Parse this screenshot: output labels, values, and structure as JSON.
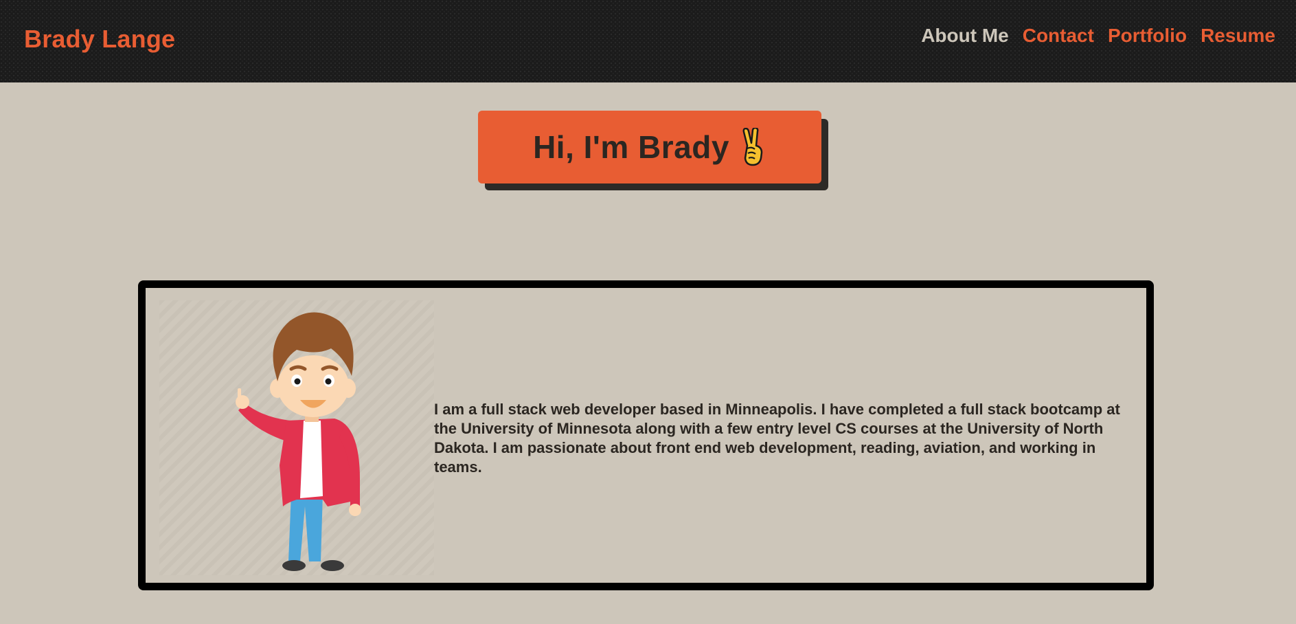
{
  "brand": {
    "name": "Brady Lange"
  },
  "nav": {
    "items": [
      {
        "label": "About Me",
        "active": true
      },
      {
        "label": "Contact",
        "active": false
      },
      {
        "label": "Portfolio",
        "active": false
      },
      {
        "label": "Resume",
        "active": false
      }
    ]
  },
  "hero": {
    "title": "Hi, I'm Brady",
    "icon": "victory-hand-icon"
  },
  "about": {
    "avatar": "cartoon-avatar",
    "bio": "I am a full stack web developer based in Minneapolis. I have completed a full stack bootcamp at the University of Minnesota along with a few entry level CS courses at the University of North Dakota. I am passionate about front end web development, reading, aviation, and working in teams."
  },
  "colors": {
    "accent": "#e85d33",
    "background": "#cdc6ba",
    "header": "#1b1b1b",
    "text": "#2b2621"
  }
}
